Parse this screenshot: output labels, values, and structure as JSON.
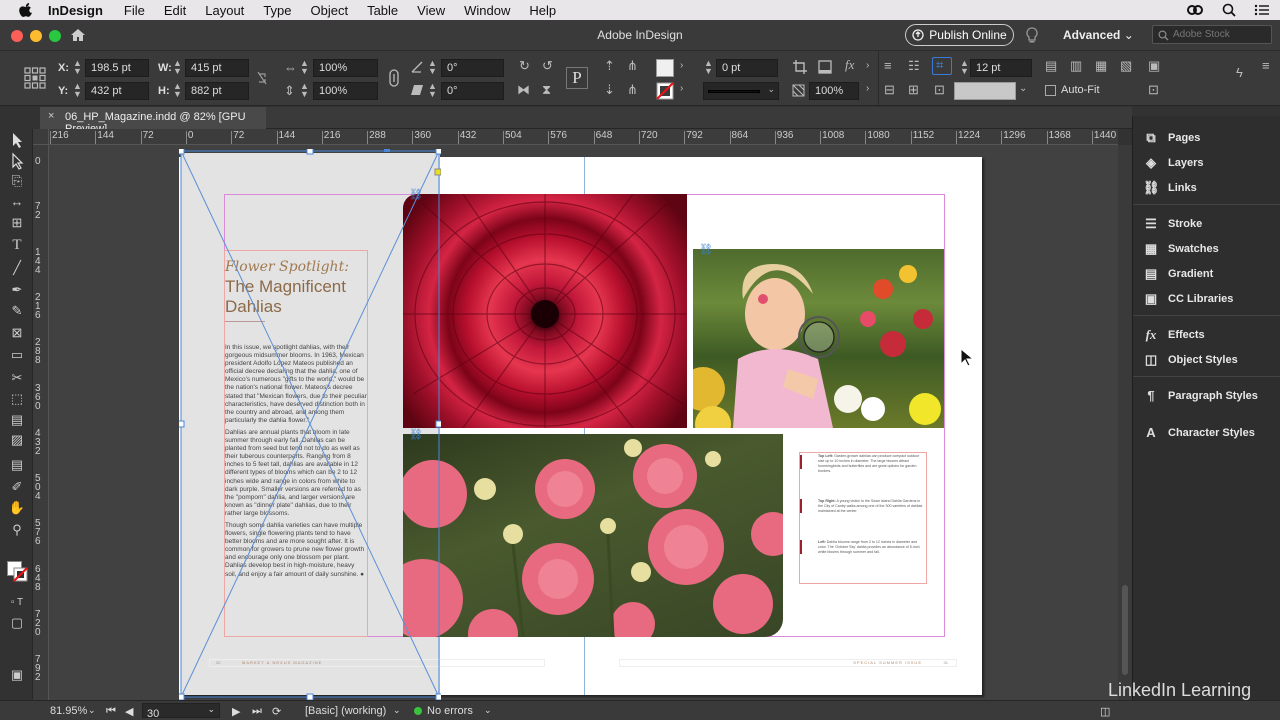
{
  "menubar": {
    "app_name": "InDesign",
    "items": [
      "File",
      "Edit",
      "Layout",
      "Type",
      "Object",
      "Table",
      "View",
      "Window",
      "Help"
    ]
  },
  "appbar": {
    "title": "Adobe InDesign",
    "publish_label": "Publish Online",
    "workspace": "Advanced",
    "stock_placeholder": "Adobe Stock"
  },
  "control": {
    "x_label": "X:",
    "x_value": "198.5 pt",
    "y_label": "Y:",
    "y_value": "432 pt",
    "w_label": "W:",
    "w_value": "415 pt",
    "h_label": "H:",
    "h_value": "882 pt",
    "scale_x": "100%",
    "scale_y": "100%",
    "rotate": "0°",
    "shear": "0°",
    "stroke_weight": "0 pt",
    "opacity": "100%",
    "column_width": "12 pt",
    "auto_fit": "Auto-Fit"
  },
  "document": {
    "tab_label": "06_HP_Magazine.indd @ 82% [GPU Preview]",
    "ruler_h": [
      "216",
      "144",
      "72",
      "0",
      "72",
      "144",
      "216",
      "288",
      "360",
      "432",
      "504",
      "576",
      "648",
      "720",
      "792",
      "864",
      "936",
      "1008",
      "1080",
      "1152",
      "1224",
      "1296",
      "1368",
      "1440"
    ],
    "ruler_v": [
      "0",
      "7 2",
      "1 4 4",
      "2 1 6",
      "2 8 8",
      "3 6 0",
      "4 3 2",
      "5 0 4",
      "5 7 6",
      "6 4 8",
      "7 2 0",
      "7 9 2",
      "8"
    ]
  },
  "article": {
    "kicker": "Flower Spotlight:",
    "title": "The Magnificent Dahlias",
    "p1": "In this issue, we spotlight dahlias, with their gorgeous midsummer blooms. In 1963, Mexican president Adolfo López Mateos published an official decree declaring that the dahlia, one of Mexico's numerous \"gifts to the world,\" would be the nation's national flower. Mateos's decree stated that \"Mexican flowers, due to their peculiar characteristics, have deserved distinction both in the country and abroad, and among them particularly the dahlia flower.\"",
    "p2": "Dahlias are annual plants that bloom in late summer through early fall. Dahlias can be planted from seed but tend not to do as well as their tuberous counterparts. Ranging from 8 inches to 5 feet tall, dahlias are available in 12 different types of blooms which can be 2 to 12 inches wide and range in colors from white to dark purple. Smaller versions are referred to as the \"pompom\" dahlia, and larger versions are known as \"dinner plate\" dahlias, due to their rather large blossoms.",
    "p3": "Though some dahlia varieties can have multiple flowers, single flowering plants tend to have better blooms and are more sought after. It is common for growers to prune new flower growth and encourage only one blossom per plant. Dahlias develop best in high-moisture, heavy soil, and enjoy a fair amount of daily sunshine. ●",
    "captions": [
      {
        "lead": "Top Left:",
        "text": " Garden-grower dahlias can produce compact outdoor size up to 10 inches in diameter. The large blooms attract hummingbirds and butterflies and are great options for garden borders."
      },
      {
        "lead": "Top Right:",
        "text": " A young visitor to the Swan Island Dahlia Gardens in the City of Canby walks among one of the 300 varieties of dahlias maintained at the center."
      },
      {
        "lead": "Left:",
        "text": " Dahlia blooms range from 2 to 12 inches in diameter and color. The 'October Sky' dahlia provides an abundance of 5-inch white blooms through summer and fall."
      }
    ],
    "footer_left_num": "30",
    "footer_left": "MARKET & NEXUS MAGAZINE",
    "footer_right": "SPECIAL SUMMER ISSUE",
    "footer_right_num": "31"
  },
  "panel": {
    "items": [
      "Pages",
      "Layers",
      "Links",
      "Stroke",
      "Swatches",
      "Gradient",
      "CC Libraries",
      "Effects",
      "Object Styles",
      "Paragraph Styles",
      "Character Styles"
    ]
  },
  "status": {
    "zoom": "81.95%",
    "page": "30",
    "master": "[Basic] (working)",
    "preflight": "No errors",
    "watermark": "LinkedIn Learning"
  }
}
